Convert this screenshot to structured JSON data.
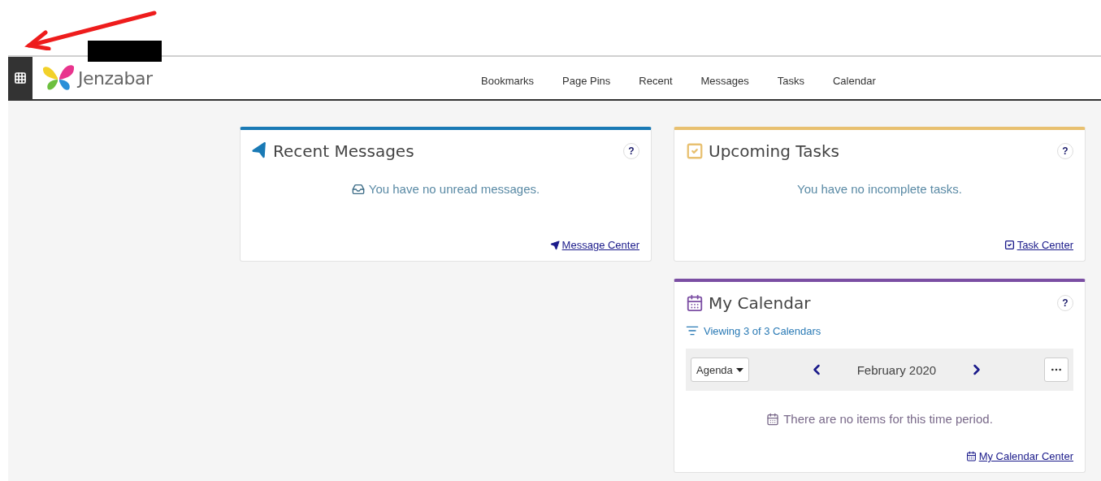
{
  "annotation": {
    "kind": "arrow",
    "color": "#ee1c1c"
  },
  "header": {
    "logo": "Jenzabar",
    "nav": [
      "Bookmarks",
      "Page Pins",
      "Recent",
      "Messages",
      "Tasks",
      "Calendar"
    ]
  },
  "cards": [
    {
      "kind": "messages",
      "title": "Recent Messages",
      "help": "?",
      "color": "#1a7ab5",
      "empty": "You have no unread messages.",
      "link": "Message Center"
    },
    {
      "kind": "tasks",
      "title": "Upcoming Tasks",
      "help": "?",
      "color": "#e8c070",
      "empty": "You have no incomplete tasks.",
      "link": "Task Center"
    },
    {
      "kind": "calendar",
      "title": "My Calendar",
      "help": "?",
      "color": "#7b4ea3",
      "filter": "Viewing 3 of 3 Calendars",
      "view": "Agenda",
      "month": "February 2020",
      "empty": "There are no items for this time period.",
      "link": "My Calendar Center"
    }
  ]
}
